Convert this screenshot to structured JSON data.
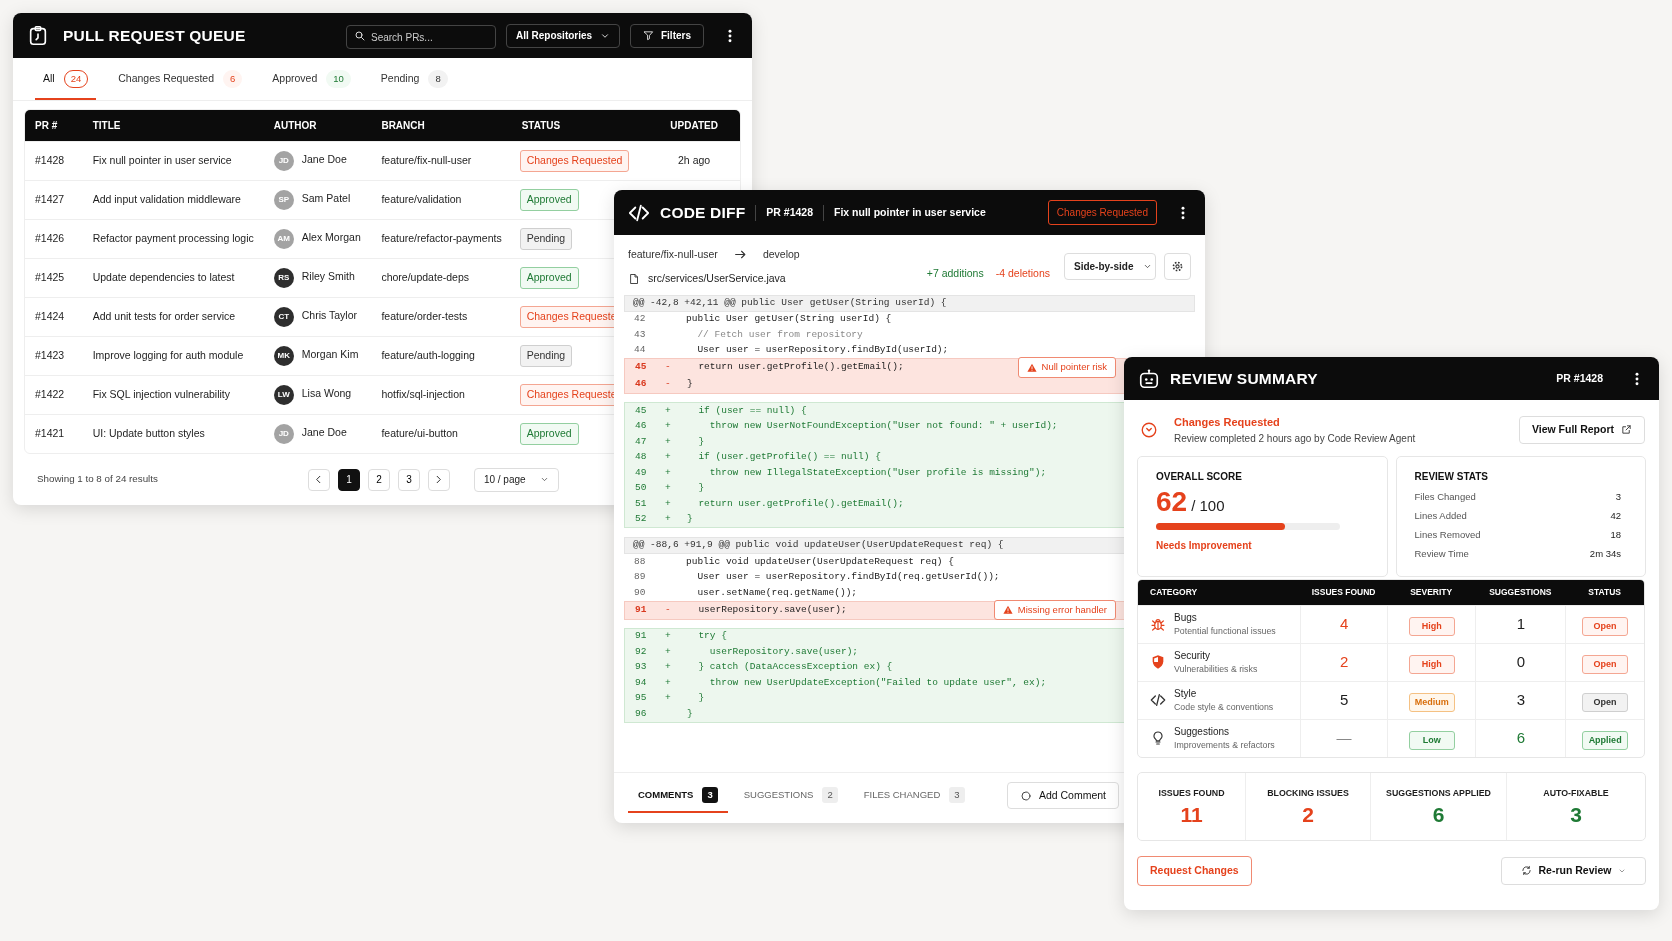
{
  "pr_queue": {
    "title": "PULL REQUEST QUEUE",
    "search": {
      "placeholder": "Search PRs..."
    },
    "repo_select": "All Repositories",
    "filters_button": "Filters",
    "tabs": [
      {
        "label": "All",
        "count": "24",
        "kind": "danger",
        "selected": true
      },
      {
        "label": "Changes Requested",
        "count": "6",
        "kind": "danger",
        "selected": false
      },
      {
        "label": "Approved",
        "count": "10",
        "kind": "success",
        "selected": false
      },
      {
        "label": "Pending",
        "count": "8",
        "kind": "neutral",
        "selected": false
      }
    ],
    "table": {
      "columns": [
        "PR #",
        "TITLE",
        "AUTHOR",
        "BRANCH",
        "STATUS",
        "UPDATED"
      ],
      "rows": [
        {
          "pr": "#1428",
          "title": "Fix null pointer in user service",
          "author": {
            "initials": "JD",
            "name": "Jane Doe",
            "color": "#a3a3a3"
          },
          "branch": "feature/fix-null-user",
          "status": {
            "text": "Changes Requested",
            "kind": "danger"
          },
          "updated": "2h ago"
        },
        {
          "pr": "#1427",
          "title": "Add input validation middleware",
          "author": {
            "initials": "SP",
            "name": "Sam Patel",
            "color": "#a3a3a3"
          },
          "branch": "feature/validation",
          "status": {
            "text": "Approved",
            "kind": "success"
          }
        },
        {
          "pr": "#1426",
          "title": "Refactor payment processing logic",
          "author": {
            "initials": "AM",
            "name": "Alex Morgan",
            "color": "#a3a3a3"
          },
          "branch": "feature/refactor-payments",
          "status": {
            "text": "Pending",
            "kind": "neutral"
          }
        },
        {
          "pr": "#1425",
          "title": "Update dependencies to latest",
          "author": {
            "initials": "RS",
            "name": "Riley Smith",
            "color": "#2e2e2e"
          },
          "branch": "chore/update-deps",
          "status": {
            "text": "Approved",
            "kind": "success"
          }
        },
        {
          "pr": "#1424",
          "title": "Add unit tests for order service",
          "author": {
            "initials": "CT",
            "name": "Chris Taylor",
            "color": "#2e2e2e"
          },
          "branch": "feature/order-tests",
          "status": {
            "text": "Changes Requeste",
            "kind": "danger"
          }
        },
        {
          "pr": "#1423",
          "title": "Improve logging for auth module",
          "author": {
            "initials": "MK",
            "name": "Morgan Kim",
            "color": "#2e2e2e"
          },
          "branch": "feature/auth-logging",
          "status": {
            "text": "Pending",
            "kind": "neutral"
          }
        },
        {
          "pr": "#1422",
          "title": "Fix SQL injection vulnerability",
          "author": {
            "initials": "LW",
            "name": "Lisa Wong",
            "color": "#2e2e2e"
          },
          "branch": "hotfix/sql-injection",
          "status": {
            "text": "Changes Requeste",
            "kind": "danger"
          }
        },
        {
          "pr": "#1421",
          "title": "UI: Update button styles",
          "author": {
            "initials": "JD",
            "name": "Jane Doe",
            "color": "#a3a3a3"
          },
          "branch": "feature/ui-button",
          "status": {
            "text": "Approved",
            "kind": "success"
          }
        }
      ]
    },
    "footer": {
      "summary": "Showing 1 to 8 of 24 results",
      "pages": [
        {
          "label": "1",
          "selected": true
        },
        {
          "label": "2",
          "selected": false
        },
        {
          "label": "3",
          "selected": false
        }
      ],
      "page_size": "10 / page"
    }
  },
  "code_diff": {
    "title": "CODE DIFF",
    "pr": "PR #1428",
    "pr_title": "Fix null pointer in user service",
    "status": {
      "text": "Changes Requested",
      "kind": "danger"
    },
    "source_branch": "feature/fix-null-user",
    "target_branch": "develop",
    "file": "src/services/UserService.java",
    "additions": "+7 additions",
    "deletions": "-4 deletions",
    "view_select": "Side-by-side",
    "hunks": [
      {
        "header": "@@ -42,8 +42,11 @@ public User getUser(String userId) {",
        "blocks": [
          {
            "kind": "context",
            "lines": [
              {
                "number": "42",
                "code": "public User getUser(String userId) {"
              },
              {
                "number": "43",
                "code": "  // Fetch user from repository",
                "comment": true
              },
              {
                "number": "44",
                "code": "  User user = userRepository.findById(userId);"
              }
            ]
          },
          {
            "kind": "removed",
            "lines": [
              {
                "number": "45",
                "sign": "-",
                "code": "  return user.getProfile().getEmail();",
                "note": "Null pointer risk"
              },
              {
                "number": "46",
                "sign": "-",
                "code": "}"
              }
            ]
          },
          {
            "kind": "added",
            "lines": [
              {
                "number": "45",
                "sign": "+",
                "code": "  if (user == null) {"
              },
              {
                "number": "46",
                "sign": "+",
                "code": "    throw new UserNotFoundException(\"User not found: \" + userId);"
              },
              {
                "number": "47",
                "sign": "+",
                "code": "  }"
              },
              {
                "number": "48",
                "sign": "+",
                "code": "  if (user.getProfile() == null) {"
              },
              {
                "number": "49",
                "sign": "+",
                "code": "    throw new IllegalStateException(\"User profile is missing\");"
              },
              {
                "number": "50",
                "sign": "+",
                "code": "  }"
              },
              {
                "number": "51",
                "sign": "+",
                "code": "  return user.getProfile().getEmail();"
              },
              {
                "number": "52",
                "sign": "+",
                "code": "}"
              }
            ]
          }
        ]
      },
      {
        "header": "@@ -88,6 +91,9 @@ public void updateUser(UserUpdateRequest req) {",
        "blocks": [
          {
            "kind": "context",
            "lines": [
              {
                "number": "88",
                "code": "public void updateUser(UserUpdateRequest req) {"
              },
              {
                "number": "89",
                "code": "  User user = userRepository.findById(req.getUserId());"
              },
              {
                "number": "90",
                "code": "  user.setName(req.getName());"
              }
            ]
          },
          {
            "kind": "removed",
            "lines": [
              {
                "number": "91",
                "sign": "-",
                "code": "  userRepository.save(user);",
                "note": "Missing error handler"
              }
            ]
          },
          {
            "kind": "added",
            "lines": [
              {
                "number": "91",
                "sign": "+",
                "code": "  try {"
              },
              {
                "number": "92",
                "sign": "+",
                "code": "    userRepository.save(user);"
              },
              {
                "number": "93",
                "sign": "+",
                "code": "  } catch (DataAccessException ex) {"
              },
              {
                "number": "94",
                "sign": "+",
                "code": "    throw new UserUpdateException(\"Failed to update user\", ex);"
              },
              {
                "number": "95",
                "sign": "+",
                "code": "  }"
              },
              {
                "number": "96",
                "code": "}"
              }
            ]
          }
        ]
      }
    ],
    "tabs": [
      {
        "label": "COMMENTS",
        "count": "3",
        "selected": true
      },
      {
        "label": "SUGGESTIONS",
        "count": "2",
        "selected": false
      },
      {
        "label": "FILES CHANGED",
        "count": "3",
        "selected": false
      }
    ],
    "add_comment_button": "Add Comment"
  },
  "review_summary": {
    "title": "REVIEW SUMMARY",
    "pr": "PR #1428",
    "status": "Changes Requested",
    "status_detail": "Review completed 2 hours ago by Code Review Agent",
    "view_report_button": "View Full Report",
    "score": {
      "label": "OVERALL SCORE",
      "value": "62",
      "max": "/ 100",
      "level": 0.7,
      "rating": "Needs Improvement"
    },
    "stats": {
      "label": "REVIEW STATS",
      "items": [
        {
          "label": "Files Changed",
          "value": "3"
        },
        {
          "label": "Lines Added",
          "value": "42"
        },
        {
          "label": "Lines Removed",
          "value": "18"
        },
        {
          "label": "Review Time",
          "value": "2m 34s"
        }
      ]
    },
    "categories": {
      "columns": [
        "CATEGORY",
        "ISSUES FOUND",
        "SEVERITY",
        "SUGGESTIONS",
        "STATUS"
      ],
      "rows": [
        {
          "kind": "bug",
          "name": "Bugs",
          "description": "Potential functional issues",
          "issues": {
            "text": "4",
            "kind": "danger"
          },
          "severity": {
            "text": "High",
            "kind": "danger"
          },
          "suggestions": {
            "text": "1",
            "kind": "plain"
          },
          "status": {
            "text": "Open",
            "kind": "danger"
          }
        },
        {
          "kind": "security",
          "name": "Security",
          "description": "Vulnerabilities & risks",
          "issues": {
            "text": "2",
            "kind": "danger"
          },
          "severity": {
            "text": "High",
            "kind": "danger"
          },
          "suggestions": {
            "text": "0",
            "kind": "plain"
          },
          "status": {
            "text": "Open",
            "kind": "danger"
          }
        },
        {
          "kind": "style",
          "name": "Style",
          "description": "Code style & conventions",
          "issues": {
            "text": "5",
            "kind": "plain"
          },
          "severity": {
            "text": "Medium",
            "kind": "warning"
          },
          "suggestions": {
            "text": "3",
            "kind": "plain"
          },
          "status": {
            "text": "Open",
            "kind": "neutral"
          }
        },
        {
          "kind": "idea",
          "name": "Suggestions",
          "description": "Improvements & refactors",
          "issues": {
            "text": "—",
            "kind": "muted"
          },
          "severity": {
            "text": "Low",
            "kind": "success"
          },
          "suggestions": {
            "text": "6",
            "kind": "success"
          },
          "status": {
            "text": "Applied",
            "kind": "success"
          }
        }
      ]
    },
    "totals": [
      {
        "label": "ISSUES FOUND",
        "value": "11",
        "kind": "danger"
      },
      {
        "label": "BLOCKING ISSUES",
        "value": "2",
        "kind": "danger"
      },
      {
        "label": "SUGGESTIONS APPLIED",
        "value": "6",
        "kind": "success"
      },
      {
        "label": "AUTO-FIXABLE",
        "value": "3",
        "kind": "success"
      }
    ],
    "request_changes_button": "Request Changes",
    "rerun_button": "Re-run Review"
  }
}
